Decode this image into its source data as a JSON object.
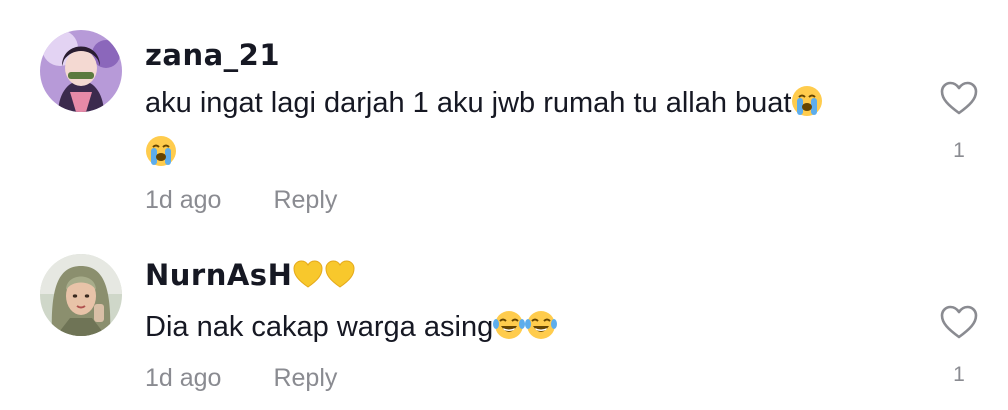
{
  "comments": [
    {
      "username": "zana_21",
      "text": "aku ingat lagi darjah 1 aku jwb rumah tu allah buat",
      "trailing_emojis": [
        "loudly-crying-face",
        "loudly-crying-face"
      ],
      "time": "1d ago",
      "reply_label": "Reply",
      "likes": "1"
    },
    {
      "username": "NurnAsH",
      "username_emojis": [
        "yellow-heart",
        "yellow-heart"
      ],
      "text": "Dia nak cakap warga asing",
      "trailing_emojis": [
        "face-with-tears-of-joy",
        "face-with-tears-of-joy"
      ],
      "time": "1d ago",
      "reply_label": "Reply",
      "likes": "1"
    }
  ],
  "colors": {
    "text": "#161823",
    "secondary": "#8a8b91",
    "heart_emoji": "#F8C82C"
  }
}
